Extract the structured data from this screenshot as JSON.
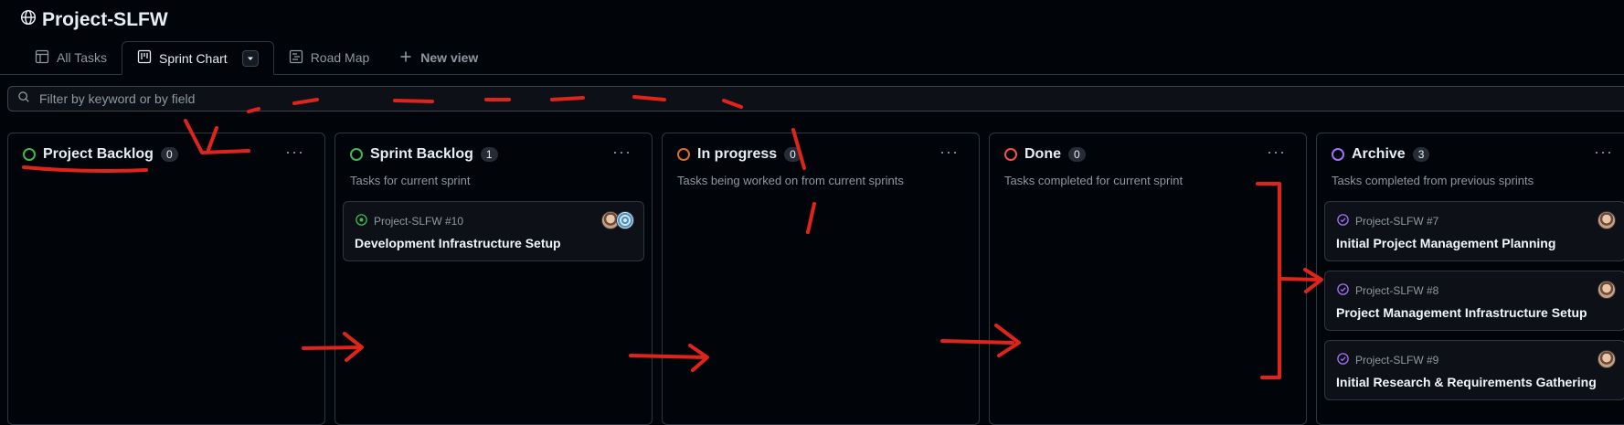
{
  "project": {
    "title": "Project-SLFW",
    "icon": "globe-icon"
  },
  "tabs": [
    {
      "label": "All Tasks",
      "icon": "table-icon",
      "active": false
    },
    {
      "label": "Sprint Chart",
      "icon": "board-icon",
      "active": true
    },
    {
      "label": "Road Map",
      "icon": "roadmap-icon",
      "active": false
    },
    {
      "label": "New view",
      "icon": "plus-icon",
      "active": false
    }
  ],
  "filter": {
    "placeholder": "Filter by keyword or by field"
  },
  "columns": [
    {
      "title": "Project Backlog",
      "count": "0",
      "description": "",
      "status_color": "#3fb950"
    },
    {
      "title": "Sprint Backlog",
      "count": "1",
      "description": "Tasks for current sprint",
      "status_color": "#3fb950"
    },
    {
      "title": "In progress",
      "count": "0",
      "description": "Tasks being worked on from current sprints",
      "status_color": "#db6d28"
    },
    {
      "title": "Done",
      "count": "0",
      "description": "Tasks completed for current sprint",
      "status_color": "#f85149"
    },
    {
      "title": "Archive",
      "count": "3",
      "description": "Tasks completed from previous sprints",
      "status_color": "#a371f7"
    }
  ],
  "cards": {
    "sprint_backlog": [
      {
        "ref": "Project-SLFW #10",
        "title": "Development Infrastructure Setup",
        "status_icon": "issue-open-icon"
      }
    ],
    "archive": [
      {
        "ref": "Project-SLFW #7",
        "title": "Initial Project Management Planning",
        "status_icon": "issue-closed-icon"
      },
      {
        "ref": "Project-SLFW #8",
        "title": "Project Management Infrastructure Setup",
        "status_icon": "issue-closed-icon"
      },
      {
        "ref": "Project-SLFW #9",
        "title": "Initial Research & Requirements Gathering",
        "status_icon": "issue-closed-icon"
      }
    ]
  },
  "menu_glyph": "···",
  "colors": {
    "annotation": "#e0241c",
    "accent_open": "#3fb950",
    "accent_done": "#a371f7"
  }
}
